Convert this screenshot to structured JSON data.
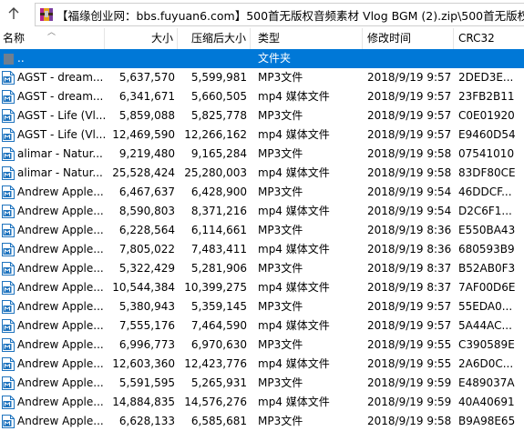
{
  "path_bar": {
    "path": "【福缘创业网：bbs.fuyuan6.com】500首无版权音频素材 Vlog BGM (2).zip\\500首无版权音乐"
  },
  "columns": {
    "name": "名称",
    "size": "大小",
    "packed": "压缩后大小",
    "type": "类型",
    "modified": "修改时间",
    "crc": "CRC32"
  },
  "parent_row": {
    "name": "..",
    "type": "文件夹"
  },
  "files": [
    {
      "name": "AGST - dream...",
      "size": "5,637,570",
      "packed": "5,599,981",
      "type": "MP3文件",
      "modified": "2018/9/19 9:57",
      "crc": "2DED3E..."
    },
    {
      "name": "AGST - dream...",
      "size": "6,341,671",
      "packed": "5,660,505",
      "type": "mp4 媒体文件",
      "modified": "2018/9/19 9:57",
      "crc": "23FB2B11"
    },
    {
      "name": "AGST - Life (Vl...",
      "size": "5,859,088",
      "packed": "5,825,778",
      "type": "MP3文件",
      "modified": "2018/9/19 9:57",
      "crc": "C0E01920"
    },
    {
      "name": "AGST - Life (Vl...",
      "size": "12,469,590",
      "packed": "12,266,162",
      "type": "mp4 媒体文件",
      "modified": "2018/9/19 9:57",
      "crc": "E9460D54"
    },
    {
      "name": "alimar - Natur...",
      "size": "9,219,480",
      "packed": "9,165,284",
      "type": "MP3文件",
      "modified": "2018/9/19 9:58",
      "crc": "07541010"
    },
    {
      "name": "alimar - Natur...",
      "size": "25,528,424",
      "packed": "25,280,003",
      "type": "mp4 媒体文件",
      "modified": "2018/9/19 9:58",
      "crc": "83DF80CE"
    },
    {
      "name": "Andrew Apple...",
      "size": "6,467,637",
      "packed": "6,428,900",
      "type": "MP3文件",
      "modified": "2018/9/19 9:54",
      "crc": "46DDCF..."
    },
    {
      "name": "Andrew Apple...",
      "size": "8,590,803",
      "packed": "8,371,216",
      "type": "mp4 媒体文件",
      "modified": "2018/9/19 9:54",
      "crc": "D2C6F1..."
    },
    {
      "name": "Andrew Apple...",
      "size": "6,228,564",
      "packed": "6,114,661",
      "type": "MP3文件",
      "modified": "2018/9/19 8:36",
      "crc": "E550BA43"
    },
    {
      "name": "Andrew Apple...",
      "size": "7,805,022",
      "packed": "7,483,411",
      "type": "mp4 媒体文件",
      "modified": "2018/9/19 8:36",
      "crc": "680593B9"
    },
    {
      "name": "Andrew Apple...",
      "size": "5,322,429",
      "packed": "5,281,906",
      "type": "MP3文件",
      "modified": "2018/9/19 8:37",
      "crc": "B52AB0F3"
    },
    {
      "name": "Andrew Apple...",
      "size": "10,544,384",
      "packed": "10,399,275",
      "type": "mp4 媒体文件",
      "modified": "2018/9/19 8:37",
      "crc": "7AF00D6E"
    },
    {
      "name": "Andrew Apple...",
      "size": "5,380,943",
      "packed": "5,359,145",
      "type": "MP3文件",
      "modified": "2018/9/19 9:57",
      "crc": "55EDA0..."
    },
    {
      "name": "Andrew Apple...",
      "size": "7,555,176",
      "packed": "7,464,590",
      "type": "mp4 媒体文件",
      "modified": "2018/9/19 9:57",
      "crc": "5A44AC..."
    },
    {
      "name": "Andrew Apple...",
      "size": "6,996,773",
      "packed": "6,970,630",
      "type": "MP3文件",
      "modified": "2018/9/19 9:55",
      "crc": "C390589E"
    },
    {
      "name": "Andrew Apple...",
      "size": "12,603,360",
      "packed": "12,423,776",
      "type": "mp4 媒体文件",
      "modified": "2018/9/19 9:55",
      "crc": "2A6D0C..."
    },
    {
      "name": "Andrew Apple...",
      "size": "5,591,595",
      "packed": "5,265,931",
      "type": "MP3文件",
      "modified": "2018/9/19 9:59",
      "crc": "E489037A"
    },
    {
      "name": "Andrew Apple...",
      "size": "14,884,835",
      "packed": "14,576,276",
      "type": "mp4 媒体文件",
      "modified": "2018/9/19 9:59",
      "crc": "40A40691"
    },
    {
      "name": "Andrew Apple...",
      "size": "6,628,133",
      "packed": "6,585,681",
      "type": "MP3文件",
      "modified": "2018/9/19 9:58",
      "crc": "B9A98E65"
    }
  ],
  "colors": {
    "selection": "#0078d7",
    "icon_badge": "#1e73be"
  }
}
